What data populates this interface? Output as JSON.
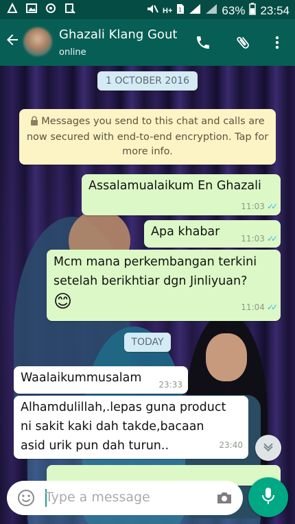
{
  "status_bar": {
    "battery_percent": "63%",
    "time": "23:54",
    "network": "H+"
  },
  "header": {
    "contact_name": "Ghazali Klang Gout",
    "presence": "online",
    "icons": [
      "back-arrow-icon",
      "phone-icon",
      "paperclip-icon",
      "more-vert-icon"
    ]
  },
  "chat": {
    "date_1": "1 OCTOBER 2016",
    "encryption_notice": "Messages you send to this chat and calls are now secured with end-to-end encryption. Tap for more info.",
    "date_2": "TODAY",
    "messages": [
      {
        "direction": "out",
        "text": "Assalamualaikum En Ghazali",
        "time": "11:03",
        "status": "read"
      },
      {
        "direction": "out",
        "text": "Apa khabar",
        "time": "11:03",
        "status": "read"
      },
      {
        "direction": "out",
        "text": "Mcm mana perkembangan terkini setelah berikhtiar dgn Jinliyuan?",
        "emoji": "😊",
        "time": "11:04",
        "status": "read"
      },
      {
        "direction": "in",
        "text": "Waalaikummusalam",
        "time": "23:33"
      },
      {
        "direction": "in",
        "text": "Alhamdulillah,.lepas guna product ni sakit kaki dah takde,bacaan asid urik pun dah turun..",
        "time": "23:40"
      }
    ]
  },
  "composer": {
    "placeholder": "Type a message"
  },
  "colors": {
    "appbar": "#075e54",
    "outgoing_bubble": "#dcf8c6",
    "incoming_bubble": "#ffffff",
    "read_ticks": "#34b7f1",
    "fab": "#00a884"
  }
}
